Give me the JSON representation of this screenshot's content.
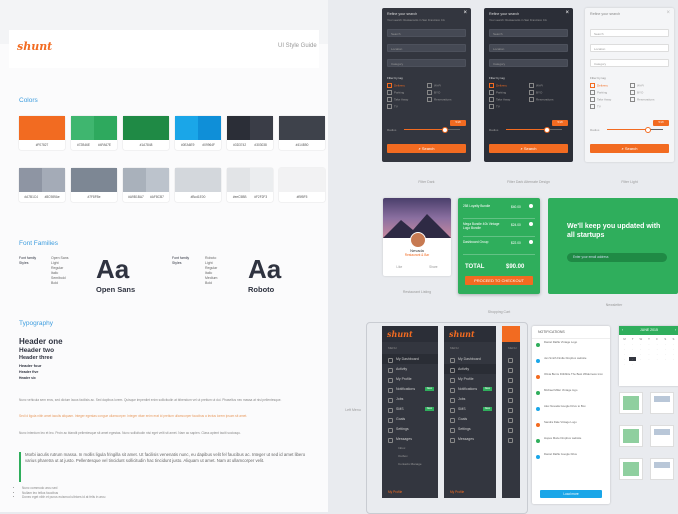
{
  "guide": {
    "logo": "shunt",
    "title": "UI Style Guide",
    "colors_title": "Colors",
    "swatch_row1": [
      {
        "cols": [
          "#f26b21"
        ],
        "hex": [
          "#F07827"
        ]
      },
      {
        "cols": [
          "#3fb66f",
          "#2ea95e"
        ],
        "hex": [
          "#72B46E",
          "#4FA67E"
        ]
      },
      {
        "cols": [
          "#1f8a45"
        ],
        "hex": [
          "#1A7848"
        ]
      },
      {
        "cols": [
          "#1aa6e8",
          "#0f8fd8"
        ],
        "hex": [
          "#0EA6E9",
          "#09964F"
        ]
      },
      {
        "cols": [
          "#2b2e37",
          "#3a3d47"
        ],
        "hex": [
          "#3D3742",
          "#303038"
        ]
      },
      {
        "cols": [
          "#3e424b"
        ],
        "hex": [
          "#414B50"
        ]
      }
    ],
    "swatch_row2": [
      {
        "cols": [
          "#8e95a3",
          "#a4abb7"
        ],
        "hex": [
          "#A7B1C4",
          "#8C989Ae"
        ]
      },
      {
        "cols": [
          "#7d8794"
        ],
        "hex": [
          "#7F8FBe"
        ]
      },
      {
        "cols": [
          "#a9b1bb",
          "#bcc3cc"
        ],
        "hex": [
          "#A9B1BA7",
          "#AF8CB7"
        ]
      },
      {
        "cols": [
          "#d3d7dc"
        ],
        "hex": [
          "#Bcd1E00"
        ]
      },
      {
        "cols": [
          "#e2e4e7",
          "#ebedef"
        ],
        "hex": [
          "#eeC5BB",
          "#F2F2F3"
        ]
      },
      {
        "cols": [
          "#f2f2f3"
        ],
        "hex": [
          "#f5f5F5"
        ]
      }
    ],
    "fonts_title": "Font Families",
    "font1": {
      "sample": "Aa",
      "name": "Open Sans",
      "family_label": "Font family",
      "styles_label": "Styles",
      "styles": [
        "Open Sans",
        "Light",
        "Regular",
        "Italic",
        "Semibold",
        "Bold"
      ]
    },
    "font2": {
      "sample": "Aa",
      "name": "Roboto",
      "family_label": "Font family",
      "styles_label": "Styles",
      "styles": [
        "Roboto",
        "Light",
        "Regular",
        "Italic",
        "Medium",
        "Bold"
      ]
    },
    "typo_title": "Typography",
    "headers": [
      "Header one",
      "Header two",
      "Header three",
      "Header four",
      "Header five",
      "Header six"
    ],
    "para1": "Nunc vehicula sem eros, sed dictum lacus facilisis ac. Sed dapibus lorem. Quisque imperdiet enim sollicitudin at bibendum vel ut pretium ut dui. Phasellus nec massa at nisl pellentesque.",
    "para2": "Sed id ligula nibh amet iaculis aliquam. Integer egestas congue ullamcorper. Integer vitae enim erat id pretium ullamcorper faucibus a lectus lorem ipsum sit amet.",
    "para3": "Nunc interdum leo et leo. Proin ac blandit pellentesque sit amet egestas. Nunc sollicitudin nisi eget velit sit amet. Nam ac sapien. Class aptent taciti sociosqu.",
    "quote": "Morbi iaculis rutrum massa. In mollis ligula fringilla sit amet. Ut facilisis venenatis nunc, eu dapibus velit fel faucibus ac. Integer ut sed id amet libero varius pharetra ut at justo. Pellentesque vel tincidunt sollicitudin hac tincidunt justo. Aliquam ut amet. Nam at ullamcorper velit.",
    "bullets": [
      "Nunc commodo arcu sed",
      "Nullam leo tellus faucibus",
      "Donec eget nibh et purus euismod ultrices id at felis in arcu"
    ]
  },
  "search_panels": [
    {
      "title": "Refine your search",
      "subtitle": "Your search: Restaurants in San Francisco CA",
      "fields": [
        "Search",
        "Location",
        "Category"
      ],
      "filter_label": "Filter by tag",
      "tags": [
        "Delivery",
        "Wi-Fi",
        "Parking",
        "BYO",
        "Take Away",
        "Reservations",
        "TV",
        ""
      ],
      "radius_label": "Radius",
      "radius_value": "5 MI",
      "button": "Search",
      "caption": "Filter Dark"
    },
    {
      "title": "Refine your search",
      "subtitle": "Your search: Restaurants in San Francisco CA",
      "fields": [
        "Search",
        "Location",
        "Category"
      ],
      "filter_label": "Filter by tag",
      "tags": [
        "Delivery",
        "Wi-Fi",
        "Parking",
        "BYO",
        "Take Away",
        "Reservations",
        "TV",
        ""
      ],
      "radius_label": "Radius",
      "radius_value": "5 MI",
      "button": "Search",
      "caption": "Filter Dark Alternate Design"
    },
    {
      "title": "Refine your search",
      "subtitle": "",
      "fields": [
        "Search",
        "Location",
        "Category"
      ],
      "filter_label": "Filter by tag",
      "tags": [
        "Delivery",
        "Wi-Fi",
        "Parking",
        "BYO",
        "Take Away",
        "Reservations",
        "TV",
        ""
      ],
      "radius_label": "Radius",
      "radius_value": "5 MI",
      "button": "Search",
      "caption": "Filter Light"
    }
  ],
  "listing": {
    "name": "Nevada",
    "sub": "Restaurant & Bar",
    "caption": "Restaurant Listing",
    "likes": "Like",
    "shares": "Share"
  },
  "cart": {
    "items": [
      {
        "name": "258 Loyalty Bundle",
        "price": "$40.00"
      },
      {
        "name": "Mega Bundle 40k Vintage Logo Bundle",
        "price": "$24.00"
      },
      {
        "name": "Dashboard Group",
        "price": "$22.00"
      }
    ],
    "total_label": "TOTAL",
    "total": "$90.00",
    "button": "PROCEED TO CHECKOUT",
    "caption": "Shopping Cart"
  },
  "newsletter": {
    "title": "We'll keep you updated with all startups",
    "placeholder": "Enter your email address",
    "caption": "Newsletter"
  },
  "menus": {
    "caption": "Left Menu",
    "menu_label": "MENU",
    "items": [
      "My Dashboard",
      "Activity",
      "My Profile",
      "Notifications",
      "Jobs",
      "SMS",
      "Goals",
      "Settings",
      "Messages"
    ],
    "sub_items": [
      "Inbox",
      "Outbox",
      "Contacts Manage"
    ],
    "profile": "My Profile",
    "badge": "New",
    "logo": "shunt"
  },
  "notifications": {
    "title": "NOTIFICATIONS",
    "items": [
      "Daniel Ratfle Vintage Logo",
      "Jan Smith Findle Dropbox website",
      "Olivia Burns Dribbble The Best Wilderness Icon",
      "Michael Miller Vintage logo",
      "Alex Nevada Google Drive to Box",
      "Sandra Dale Vintage Logo",
      "Hopes Maze Dropbox website",
      "Daniel Ratfle Google Drive"
    ],
    "button": "Load more"
  },
  "calendar": {
    "month": "JUNE 2015",
    "days": [
      "M",
      "T",
      "W",
      "T",
      "F",
      "S",
      "S"
    ]
  },
  "colors": {
    "orange": "#f26b21",
    "green": "#2fae5c",
    "dark": "#33363f",
    "blue": "#3e9dde"
  }
}
